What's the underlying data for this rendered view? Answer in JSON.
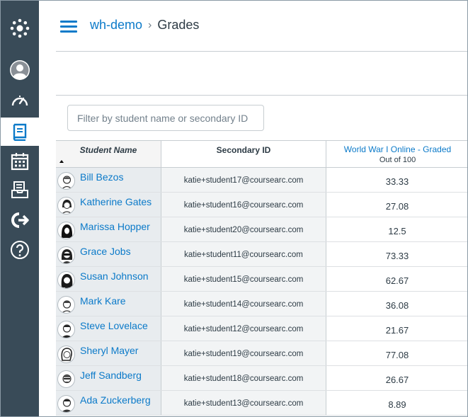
{
  "breadcrumb": {
    "course": "wh-demo",
    "separator": "›",
    "page": "Grades"
  },
  "filter": {
    "placeholder": "Filter by student name or secondary ID",
    "value": ""
  },
  "grid": {
    "headers": {
      "student": "Student Name",
      "secondary_id": "Secondary ID"
    },
    "assignment": {
      "name": "World War I Online - Graded",
      "points": "Out of 100"
    },
    "rows": [
      {
        "name": "Bill Bezos",
        "secondary_id": "katie+student17@coursearc.com",
        "grade": "33.33"
      },
      {
        "name": "Katherine Gates",
        "secondary_id": "katie+student16@coursearc.com",
        "grade": "27.08"
      },
      {
        "name": "Marissa Hopper",
        "secondary_id": "katie+student20@coursearc.com",
        "grade": "12.5"
      },
      {
        "name": "Grace Jobs",
        "secondary_id": "katie+student11@coursearc.com",
        "grade": "73.33"
      },
      {
        "name": "Susan Johnson",
        "secondary_id": "katie+student15@coursearc.com",
        "grade": "62.67"
      },
      {
        "name": "Mark Kare",
        "secondary_id": "katie+student14@coursearc.com",
        "grade": "36.08"
      },
      {
        "name": "Steve Lovelace",
        "secondary_id": "katie+student12@coursearc.com",
        "grade": "21.67"
      },
      {
        "name": "Sheryl Mayer",
        "secondary_id": "katie+student19@coursearc.com",
        "grade": "77.08"
      },
      {
        "name": "Jeff Sandberg",
        "secondary_id": "katie+student18@coursearc.com",
        "grade": "26.67"
      },
      {
        "name": "Ada Zuckerberg",
        "secondary_id": "katie+student13@coursearc.com",
        "grade": "8.89"
      }
    ]
  },
  "nav_icons": [
    "canvas-logo-icon",
    "account-icon",
    "dashboard-icon",
    "courses-icon",
    "calendar-icon",
    "inbox-icon",
    "commons-icon",
    "help-icon"
  ],
  "colors": {
    "sidebar": "#394b58",
    "link": "#0b7ac9",
    "text": "#2d3b45",
    "border": "#c7cdd1"
  }
}
